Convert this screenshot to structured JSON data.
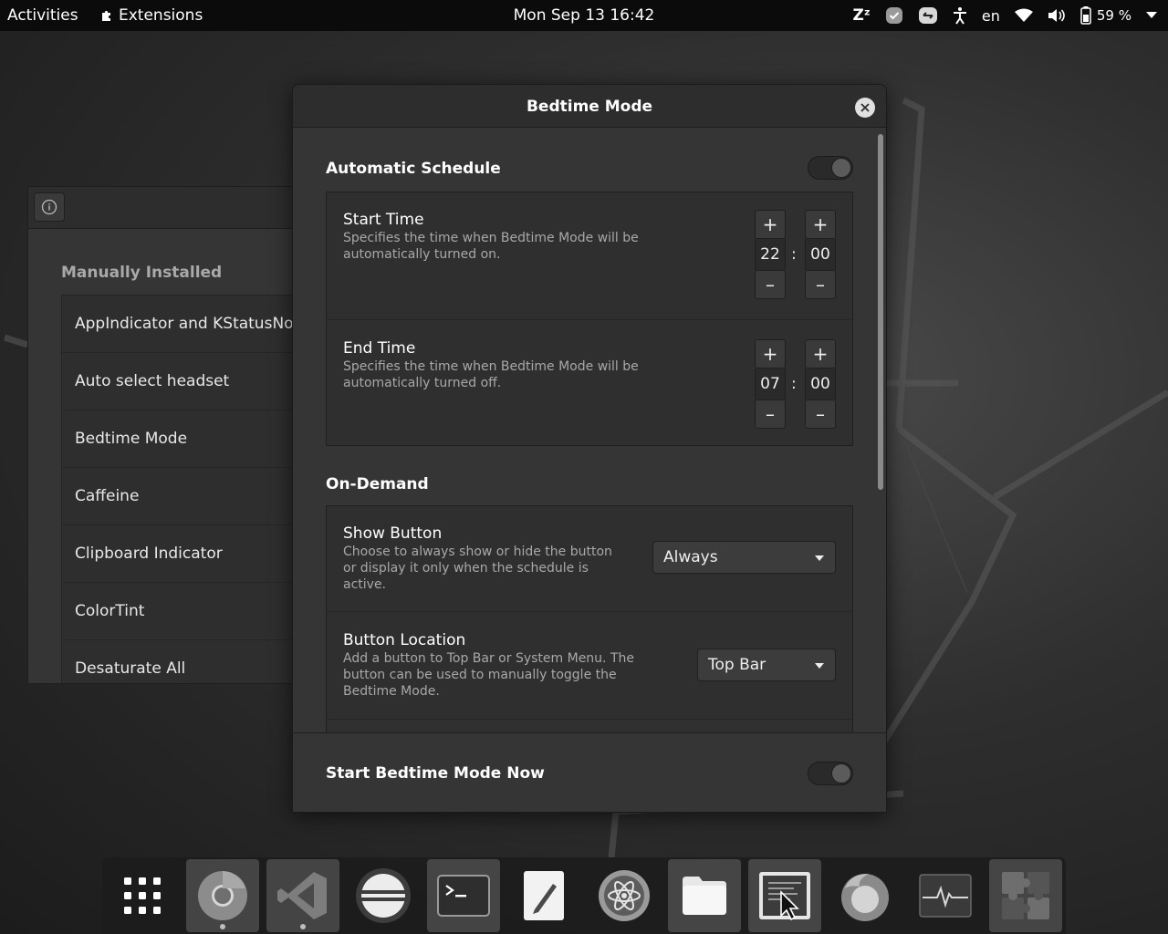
{
  "topbar": {
    "activities": "Activities",
    "extensions_menu": "Extensions",
    "clock": "Mon Sep 13  16:42",
    "language": "en",
    "battery": "59 %"
  },
  "background_window": {
    "section_title": "Manually Installed",
    "items": [
      "AppIndicator and KStatusNo",
      "Auto select headset",
      "Bedtime Mode",
      "Caffeine",
      "Clipboard Indicator",
      "ColorTint",
      "Desaturate All"
    ]
  },
  "dialog": {
    "title": "Bedtime Mode",
    "automatic_schedule": {
      "title": "Automatic Schedule",
      "enabled": false,
      "start_time": {
        "title": "Start Time",
        "description": "Specifies the time when Bedtime Mode will be automatically turned on.",
        "hour": "22",
        "minute": "00"
      },
      "end_time": {
        "title": "End Time",
        "description": "Specifies the time when Bedtime Mode will be automatically turned off.",
        "hour": "07",
        "minute": "00"
      }
    },
    "on_demand": {
      "title": "On-Demand",
      "show_button": {
        "title": "Show Button",
        "description": "Choose to always show or hide the button or display it only when the schedule is active.",
        "value": "Always"
      },
      "button_location": {
        "title": "Button Location",
        "description": "Add a button to Top Bar or System Menu. The button can be used to manually toggle the Bedtime Mode.",
        "value": "Top Bar"
      }
    },
    "footer": {
      "label": "Start Bedtime Mode Now",
      "enabled": false
    },
    "spin": {
      "plus": "+",
      "minus": "–",
      "separator": ":"
    }
  },
  "dock": {
    "items": [
      "app-grid-icon",
      "chrome-icon",
      "vscode-icon",
      "eclipse-icon",
      "terminal-icon",
      "text-editor-icon",
      "atom-icon",
      "files-icon",
      "screenshot-icon",
      "firefox-icon",
      "system-monitor-icon",
      "extensions-icon"
    ]
  }
}
